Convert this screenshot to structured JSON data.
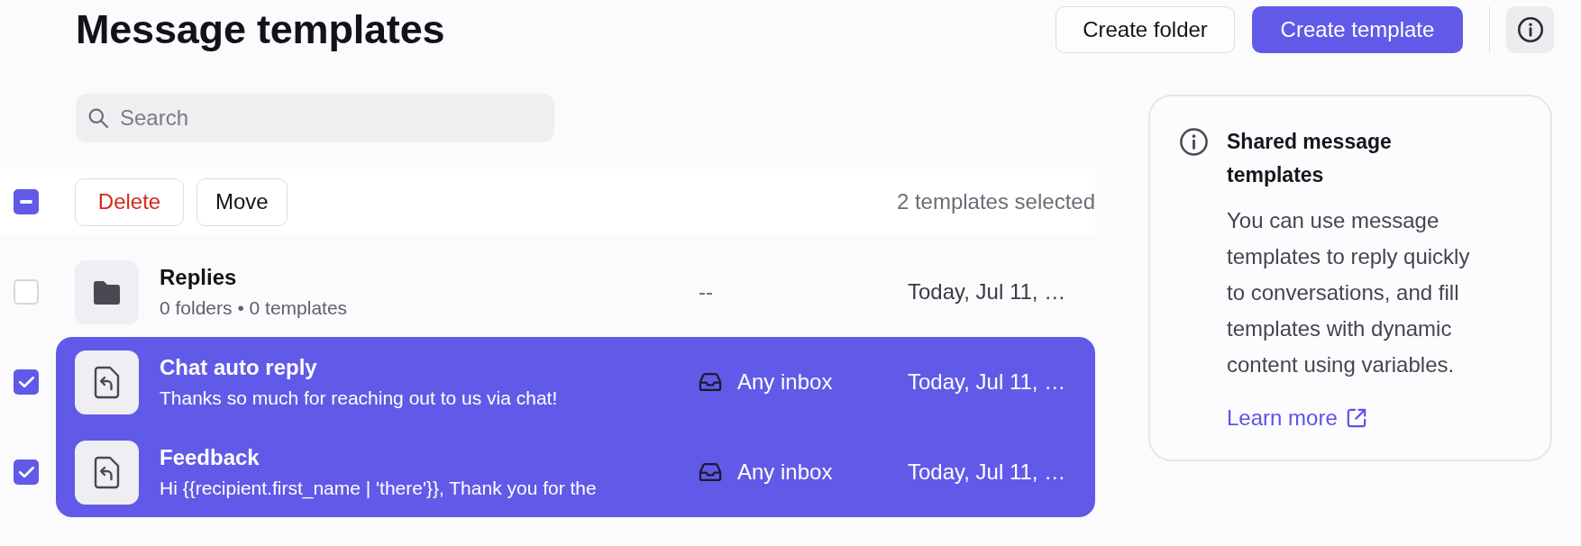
{
  "header": {
    "title": "Message templates",
    "buttons": [
      {
        "label": "Create folder",
        "kind": "secondary"
      },
      {
        "label": "Create template",
        "kind": "primary"
      }
    ]
  },
  "search": {
    "placeholder": "Search"
  },
  "bulk_actions": {
    "select_all": {
      "indeterminate": true
    },
    "buttons": [
      {
        "label": "Delete",
        "kind": "danger"
      },
      {
        "label": "Move",
        "kind": "default"
      }
    ],
    "selection_count": "2 templates selected"
  },
  "rows": [
    {
      "kind": "folder",
      "selected": false,
      "title": "Replies",
      "subtitle": "0 folders • 0 templates",
      "column_2": "--",
      "column_3": "Today, Jul 11, …"
    },
    {
      "kind": "template",
      "selected": true,
      "title": "Chat auto reply",
      "subtitle": "Thanks so much for reaching out to us via chat!",
      "column_2": "Any inbox",
      "column_3": "Today, Jul 11, …"
    },
    {
      "kind": "template",
      "selected": true,
      "title": "Feedback",
      "subtitle": "Hi {{recipient.first_name | 'there'}}, Thank you for the",
      "column_2": "Any inbox",
      "column_3": "Today, Jul 11, …"
    }
  ],
  "info_panel": {
    "title": "Shared message templates",
    "body": "You can use message templates to reply quickly to conversations, and fill templates with dynamic content using variables.",
    "link": "Learn more"
  }
}
